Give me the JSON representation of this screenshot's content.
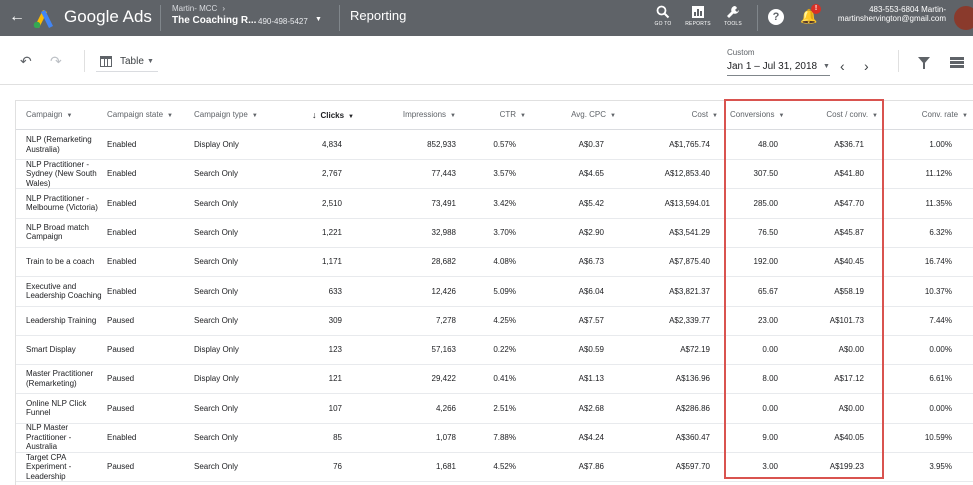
{
  "header": {
    "brand": "Google Ads",
    "account_parent": "Martin- MCC",
    "account_name": "The Coaching R...",
    "account_id": "490-498-5427",
    "section": "Reporting",
    "tools": [
      {
        "label": "GO TO",
        "icon": "search-icon"
      },
      {
        "label": "REPORTS",
        "icon": "reports-icon"
      },
      {
        "label": "TOOLS",
        "icon": "wrench-icon"
      }
    ],
    "notification_count": "!",
    "user_line1": "483-553-6804 Martin-",
    "user_line2": "martinshervington@gmail.com",
    "colors": {
      "bar": "#5f6368",
      "highlight": "#d9534f"
    }
  },
  "toolbar": {
    "view": "Table",
    "date_label": "Custom",
    "date_range": "Jan 1 – Jul 31, 2018"
  },
  "table": {
    "columns": [
      "Campaign",
      "Campaign state",
      "Campaign type",
      "Clicks",
      "Impressions",
      "CTR",
      "Avg. CPC",
      "Cost",
      "Conversions",
      "Cost / conv.",
      "Conv. rate"
    ],
    "rows": [
      [
        "NLP (Remarketing Australia)",
        "Enabled",
        "Display Only",
        "4,834",
        "852,933",
        "0.57%",
        "A$0.37",
        "A$1,765.74",
        "48.00",
        "A$36.71",
        "1.00%"
      ],
      [
        "NLP Practitioner - Sydney (New South Wales)",
        "Enabled",
        "Search Only",
        "2,767",
        "77,443",
        "3.57%",
        "A$4.65",
        "A$12,853.40",
        "307.50",
        "A$41.80",
        "11.12%"
      ],
      [
        "NLP Practitioner - Melbourne (Victoria)",
        "Enabled",
        "Search Only",
        "2,510",
        "73,491",
        "3.42%",
        "A$5.42",
        "A$13,594.01",
        "285.00",
        "A$47.70",
        "11.35%"
      ],
      [
        "NLP Broad match Campaign",
        "Enabled",
        "Search Only",
        "1,221",
        "32,988",
        "3.70%",
        "A$2.90",
        "A$3,541.29",
        "76.50",
        "A$45.87",
        "6.32%"
      ],
      [
        "Train to be a coach",
        "Enabled",
        "Search Only",
        "1,171",
        "28,682",
        "4.08%",
        "A$6.73",
        "A$7,875.40",
        "192.00",
        "A$40.45",
        "16.74%"
      ],
      [
        "Executive and Leadership Coaching",
        "Enabled",
        "Search Only",
        "633",
        "12,426",
        "5.09%",
        "A$6.04",
        "A$3,821.37",
        "65.67",
        "A$58.19",
        "10.37%"
      ],
      [
        "Leadership Training",
        "Paused",
        "Search Only",
        "309",
        "7,278",
        "4.25%",
        "A$7.57",
        "A$2,339.77",
        "23.00",
        "A$101.73",
        "7.44%"
      ],
      [
        "Smart Display",
        "Paused",
        "Display Only",
        "123",
        "57,163",
        "0.22%",
        "A$0.59",
        "A$72.19",
        "0.00",
        "A$0.00",
        "0.00%"
      ],
      [
        "Master Practitioner (Remarketing)",
        "Paused",
        "Display Only",
        "121",
        "29,422",
        "0.41%",
        "A$1.13",
        "A$136.96",
        "8.00",
        "A$17.12",
        "6.61%"
      ],
      [
        "Online NLP Click Funnel",
        "Paused",
        "Search Only",
        "107",
        "4,266",
        "2.51%",
        "A$2.68",
        "A$286.86",
        "0.00",
        "A$0.00",
        "0.00%"
      ],
      [
        "NLP Master Practitioner - Australia",
        "Enabled",
        "Search Only",
        "85",
        "1,078",
        "7.88%",
        "A$4.24",
        "A$360.47",
        "9.00",
        "A$40.05",
        "10.59%"
      ],
      [
        "Target CPA Experiment - Leadership",
        "Paused",
        "Search Only",
        "76",
        "1,681",
        "4.52%",
        "A$7.86",
        "A$597.70",
        "3.00",
        "A$199.23",
        "3.95%"
      ]
    ]
  }
}
